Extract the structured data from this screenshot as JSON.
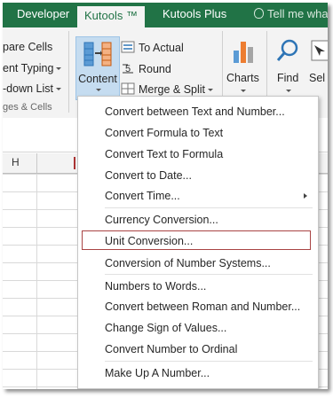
{
  "tabs": [
    {
      "label": "Developer",
      "active": false
    },
    {
      "label": "Kutools ™",
      "active": true
    },
    {
      "label": "Kutools Plus",
      "active": false
    }
  ],
  "tell_me": "Tell me what y",
  "ribbon": {
    "left_items": [
      "pare Cells",
      "ent Typing",
      "-down List"
    ],
    "group_label": "ges & Cells",
    "content_label": "Content",
    "to_actual": "To Actual",
    "round": "Round",
    "merge_split": "Merge & Split",
    "charts": "Charts",
    "find": "Find",
    "sel": "Sel"
  },
  "sheet": {
    "column_h": "H"
  },
  "menu": {
    "items": [
      {
        "label": "Convert between Text and Number...",
        "separator_before": false
      },
      {
        "label": "Convert Formula to Text",
        "separator_before": false
      },
      {
        "label": "Convert Text to Formula",
        "separator_before": false
      },
      {
        "label": "Convert to Date...",
        "separator_before": false
      },
      {
        "label": "Convert Time...",
        "separator_before": false,
        "submenu": true
      },
      {
        "label": "Currency Conversion...",
        "separator_before": true
      },
      {
        "label": "Unit Conversion...",
        "separator_before": false,
        "selected": true
      },
      {
        "label": "Conversion of Number Systems...",
        "separator_before": false
      },
      {
        "label": "Numbers to Words...",
        "separator_before": true
      },
      {
        "label": "Convert between Roman and Number...",
        "separator_before": false
      },
      {
        "label": "Change Sign of Values...",
        "separator_before": false
      },
      {
        "label": "Convert Number to Ordinal",
        "separator_before": false
      },
      {
        "label": "Make Up A Number...",
        "separator_before": true
      }
    ]
  },
  "colors": {
    "ribbon_green": "#217346",
    "selected_border": "#a94444",
    "content_button": "#c5dcf0"
  }
}
